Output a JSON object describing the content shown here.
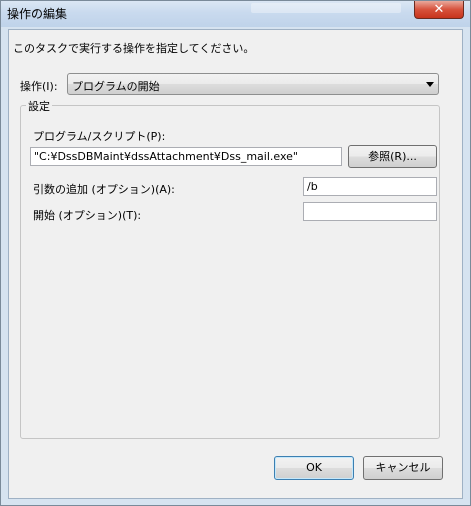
{
  "window": {
    "title": "操作の編集",
    "close_glyph": "✕"
  },
  "instruction": "このタスクで実行する操作を指定してください。",
  "action": {
    "label": "操作(I):",
    "value": "プログラムの開始"
  },
  "settings": {
    "legend": "設定",
    "program": {
      "label": "プログラム/スクリプト(P):",
      "value": "\"C:¥DssDBMaint¥dssAttachment¥Dss_mail.exe\"",
      "browse_label": "参照(R)..."
    },
    "arguments": {
      "label": "引数の追加 (オプション)(A):",
      "value": "/b"
    },
    "start_in": {
      "label": "開始 (オプション)(T):",
      "value": ""
    }
  },
  "buttons": {
    "ok": "OK",
    "cancel": "キャンセル"
  },
  "colors": {
    "titlebar": "#c9daee",
    "close_button": "#d7523c",
    "dialog_background": "#f0f0f0",
    "default_button_border": "#3c7fb1"
  },
  "icons": {
    "close": "close-icon",
    "dropdown": "chevron-down-icon"
  }
}
